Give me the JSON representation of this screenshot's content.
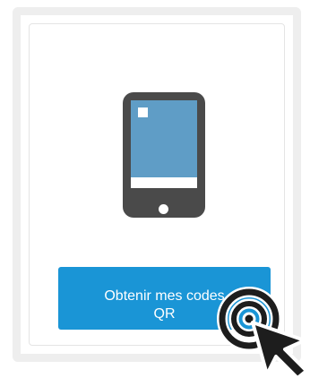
{
  "card": {
    "button": {
      "label_line1": "Obtenir mes codes",
      "label_line2": "QR"
    }
  },
  "icons": {
    "illustration": "smartphone-icon",
    "cursor": "click-pointer-icon"
  },
  "colors": {
    "button_bg": "#1a95d6",
    "button_text": "#ffffff",
    "phone_body": "#4a4a4a",
    "phone_screen": "#5f9dc6",
    "card_border": "#eeeeee",
    "cursor": "#1d1d1d"
  }
}
